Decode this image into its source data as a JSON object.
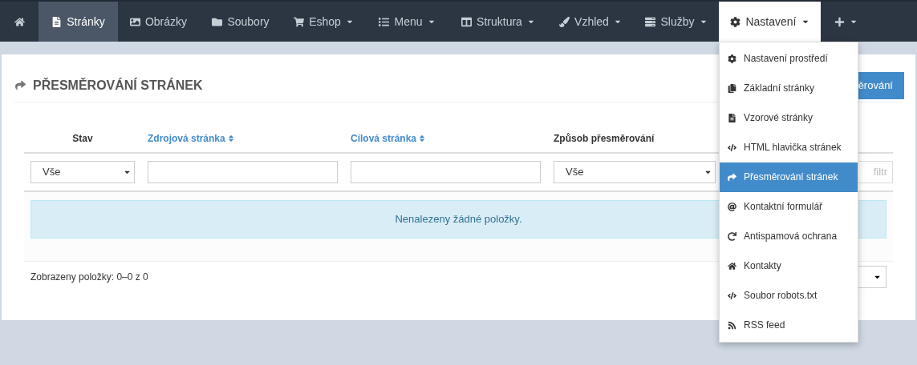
{
  "navbar": {
    "items": [
      {
        "dropdown": false,
        "selected": false,
        "expanded": false
      },
      {
        "label": "Stránky",
        "dropdown": false,
        "selected": true,
        "expanded": false
      },
      {
        "label": "Obrázky",
        "dropdown": false,
        "selected": false,
        "expanded": false
      },
      {
        "label": "Soubory",
        "dropdown": false,
        "selected": false,
        "expanded": false
      },
      {
        "label": "Eshop",
        "dropdown": true,
        "selected": false,
        "expanded": false
      },
      {
        "label": "Menu",
        "dropdown": true,
        "selected": false,
        "expanded": false
      },
      {
        "label": "Struktura",
        "dropdown": true,
        "selected": false,
        "expanded": false
      },
      {
        "label": "Vzhled",
        "dropdown": true,
        "selected": false,
        "expanded": false
      },
      {
        "label": "Služby",
        "dropdown": true,
        "selected": false,
        "expanded": false
      },
      {
        "label": "Nastavení",
        "dropdown": true,
        "selected": false,
        "expanded": true
      },
      {
        "dropdown": true,
        "selected": false,
        "expanded": false
      }
    ]
  },
  "dropdown_menu": {
    "items": [
      {
        "label": "Nastavení prostředí",
        "selected": false
      },
      {
        "label": "Základní stránky",
        "selected": false
      },
      {
        "label": "Vzorové stránky",
        "selected": false
      },
      {
        "label": "HTML hlavička stránek",
        "selected": false
      },
      {
        "label": "Přesměrování stránek",
        "selected": true
      },
      {
        "label": "Kontaktní formulář",
        "selected": false
      },
      {
        "label": "Antispamová ochrana",
        "selected": false
      },
      {
        "label": "Kontakty",
        "selected": false
      },
      {
        "label": "Soubor robots.txt",
        "selected": false
      },
      {
        "label": "RSS feed",
        "selected": false
      }
    ]
  },
  "panel": {
    "title": "PŘESMĚROVÁNÍ STRÁNEK",
    "header_button": "ěrování",
    "table": {
      "columns": [
        {
          "label": "Stav",
          "sortable": false
        },
        {
          "label": "Zdrojová stránka",
          "sortable": true
        },
        {
          "label": "Cílová stránka",
          "sortable": true
        },
        {
          "label": "Způsob přesměrování",
          "sortable": false
        }
      ],
      "filters": [
        {
          "kind": "select",
          "value": "Vše"
        },
        {
          "kind": "input"
        },
        {
          "kind": "input"
        },
        {
          "kind": "select",
          "value": "Vše"
        }
      ],
      "filter_button": "filtr",
      "empty_message": "Nenalezeny žádné položky."
    },
    "footer": {
      "summary": "Zobrazeny položky: 0–0 z 0"
    }
  }
}
